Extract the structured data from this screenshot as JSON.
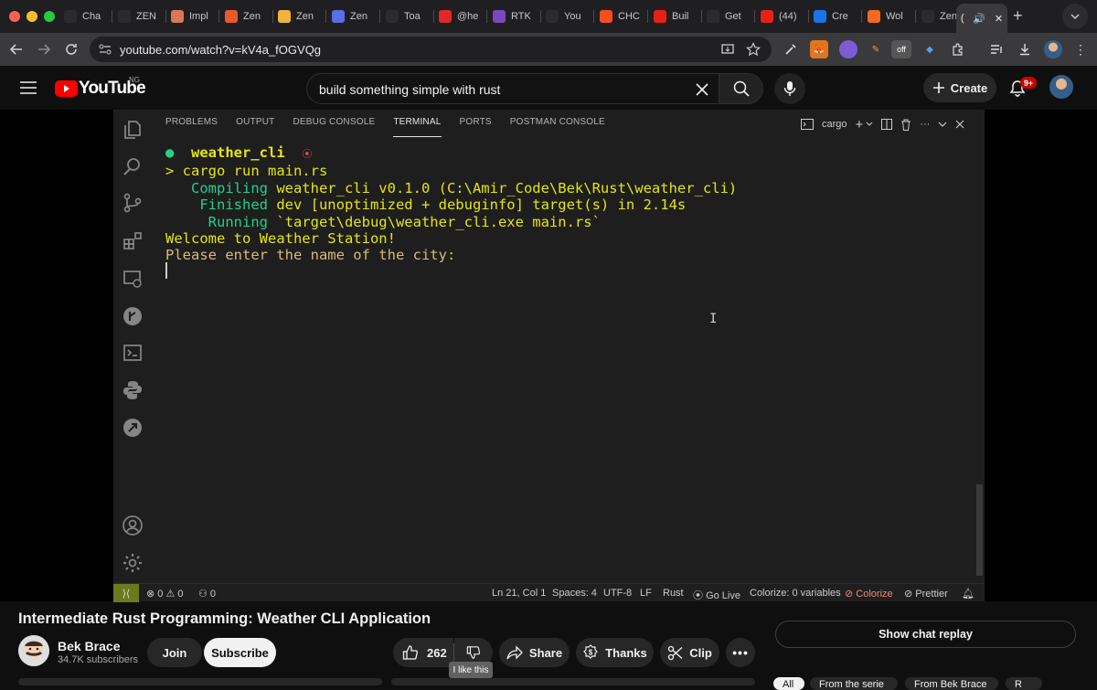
{
  "browser": {
    "tabs": [
      {
        "label": "Cha",
        "icon": "chatgpt-icon",
        "color": "#2b2b2b"
      },
      {
        "label": "ZEN",
        "icon": "globe-icon",
        "color": "#2b2b2b"
      },
      {
        "label": "Impl",
        "icon": "asterisk-icon",
        "color": "#d97757"
      },
      {
        "label": "Zen",
        "icon": "zen-icon",
        "color": "#e95a2a"
      },
      {
        "label": "Zen",
        "icon": "hand-icon",
        "color": "#f0b43c"
      },
      {
        "label": "Zen",
        "icon": "blob-icon",
        "color": "#5a6ee8"
      },
      {
        "label": "Toa",
        "icon": "slash-icon",
        "color": "#2b2b2b"
      },
      {
        "label": "@he",
        "icon": "flipboard-icon",
        "color": "#e12828"
      },
      {
        "label": "RTK",
        "icon": "redux-icon",
        "color": "#764abc"
      },
      {
        "label": "You",
        "icon": "github-icon",
        "color": "#2b2b2b"
      },
      {
        "label": "CHC",
        "icon": "figma-icon",
        "color": "#f24e1e"
      },
      {
        "label": "Buil",
        "icon": "youtube-icon",
        "color": "#e62117"
      },
      {
        "label": "Get",
        "icon": "react-icon",
        "color": "#2b2b2b"
      },
      {
        "label": "(44)",
        "icon": "youtube-icon",
        "color": "#e62117"
      },
      {
        "label": "Cre",
        "icon": "c-icon",
        "color": "#1b73e8"
      },
      {
        "label": "Wol",
        "icon": "ls-icon",
        "color": "#f26b21"
      },
      {
        "label": "Zen",
        "icon": "github-icon",
        "color": "#2b2b2b"
      }
    ],
    "active_tab_label": "(",
    "url": "youtube.com/watch?v=kV4a_fOGVQg",
    "ext_off_label": "off"
  },
  "youtube": {
    "logo_text": "YouTube",
    "country_code": "NG",
    "search_query": "build something simple with rust",
    "create_label": "Create",
    "notification_count": "9+"
  },
  "vscode": {
    "panel_tabs": [
      "PROBLEMS",
      "OUTPUT",
      "DEBUG CONSOLE",
      "TERMINAL",
      "PORTS",
      "POSTMAN CONSOLE"
    ],
    "active_panel_tab": "TERMINAL",
    "terminal_name": "cargo",
    "terminal": {
      "folder": "weather_cli",
      "command": "> cargo run main.rs",
      "lines": [
        {
          "verb": "   Compiling",
          "rest": " weather_cli v0.1.0 (C:\\Amir_Code\\Bek\\Rust\\weather_cli)"
        },
        {
          "verb": "    Finished",
          "rest": " dev [unoptimized + debuginfo] target(s) in 2.14s"
        },
        {
          "verb": "     Running",
          "rest": " `target\\debug\\weather_cli.exe main.rs`"
        }
      ],
      "output1": "Welcome to Weather Station!",
      "output2": "Please enter the name of the city:"
    },
    "status": {
      "errors": "0",
      "warnings": "0",
      "ports": "0",
      "position": "Ln 21, Col 1",
      "spaces": "Spaces: 4",
      "encoding": "UTF-8",
      "eol": "LF",
      "language": "Rust",
      "golive": "Go Live",
      "colorize_vars": "Colorize: 0 variables",
      "colorize": "Colorize",
      "prettier": "Prettier"
    }
  },
  "video": {
    "title": "Intermediate Rust Programming: Weather CLI Application",
    "channel": "Bek Brace",
    "subscribers": "34.7K subscribers",
    "join_label": "Join",
    "subscribe_label": "Subscribe",
    "likes": "262",
    "dislike_tooltip": "I like this",
    "share_label": "Share",
    "thanks_label": "Thanks",
    "clip_label": "Clip",
    "chat_replay_label": "Show chat replay"
  },
  "chips": [
    "All",
    "From the serie",
    "From Bek Brace",
    "R"
  ]
}
